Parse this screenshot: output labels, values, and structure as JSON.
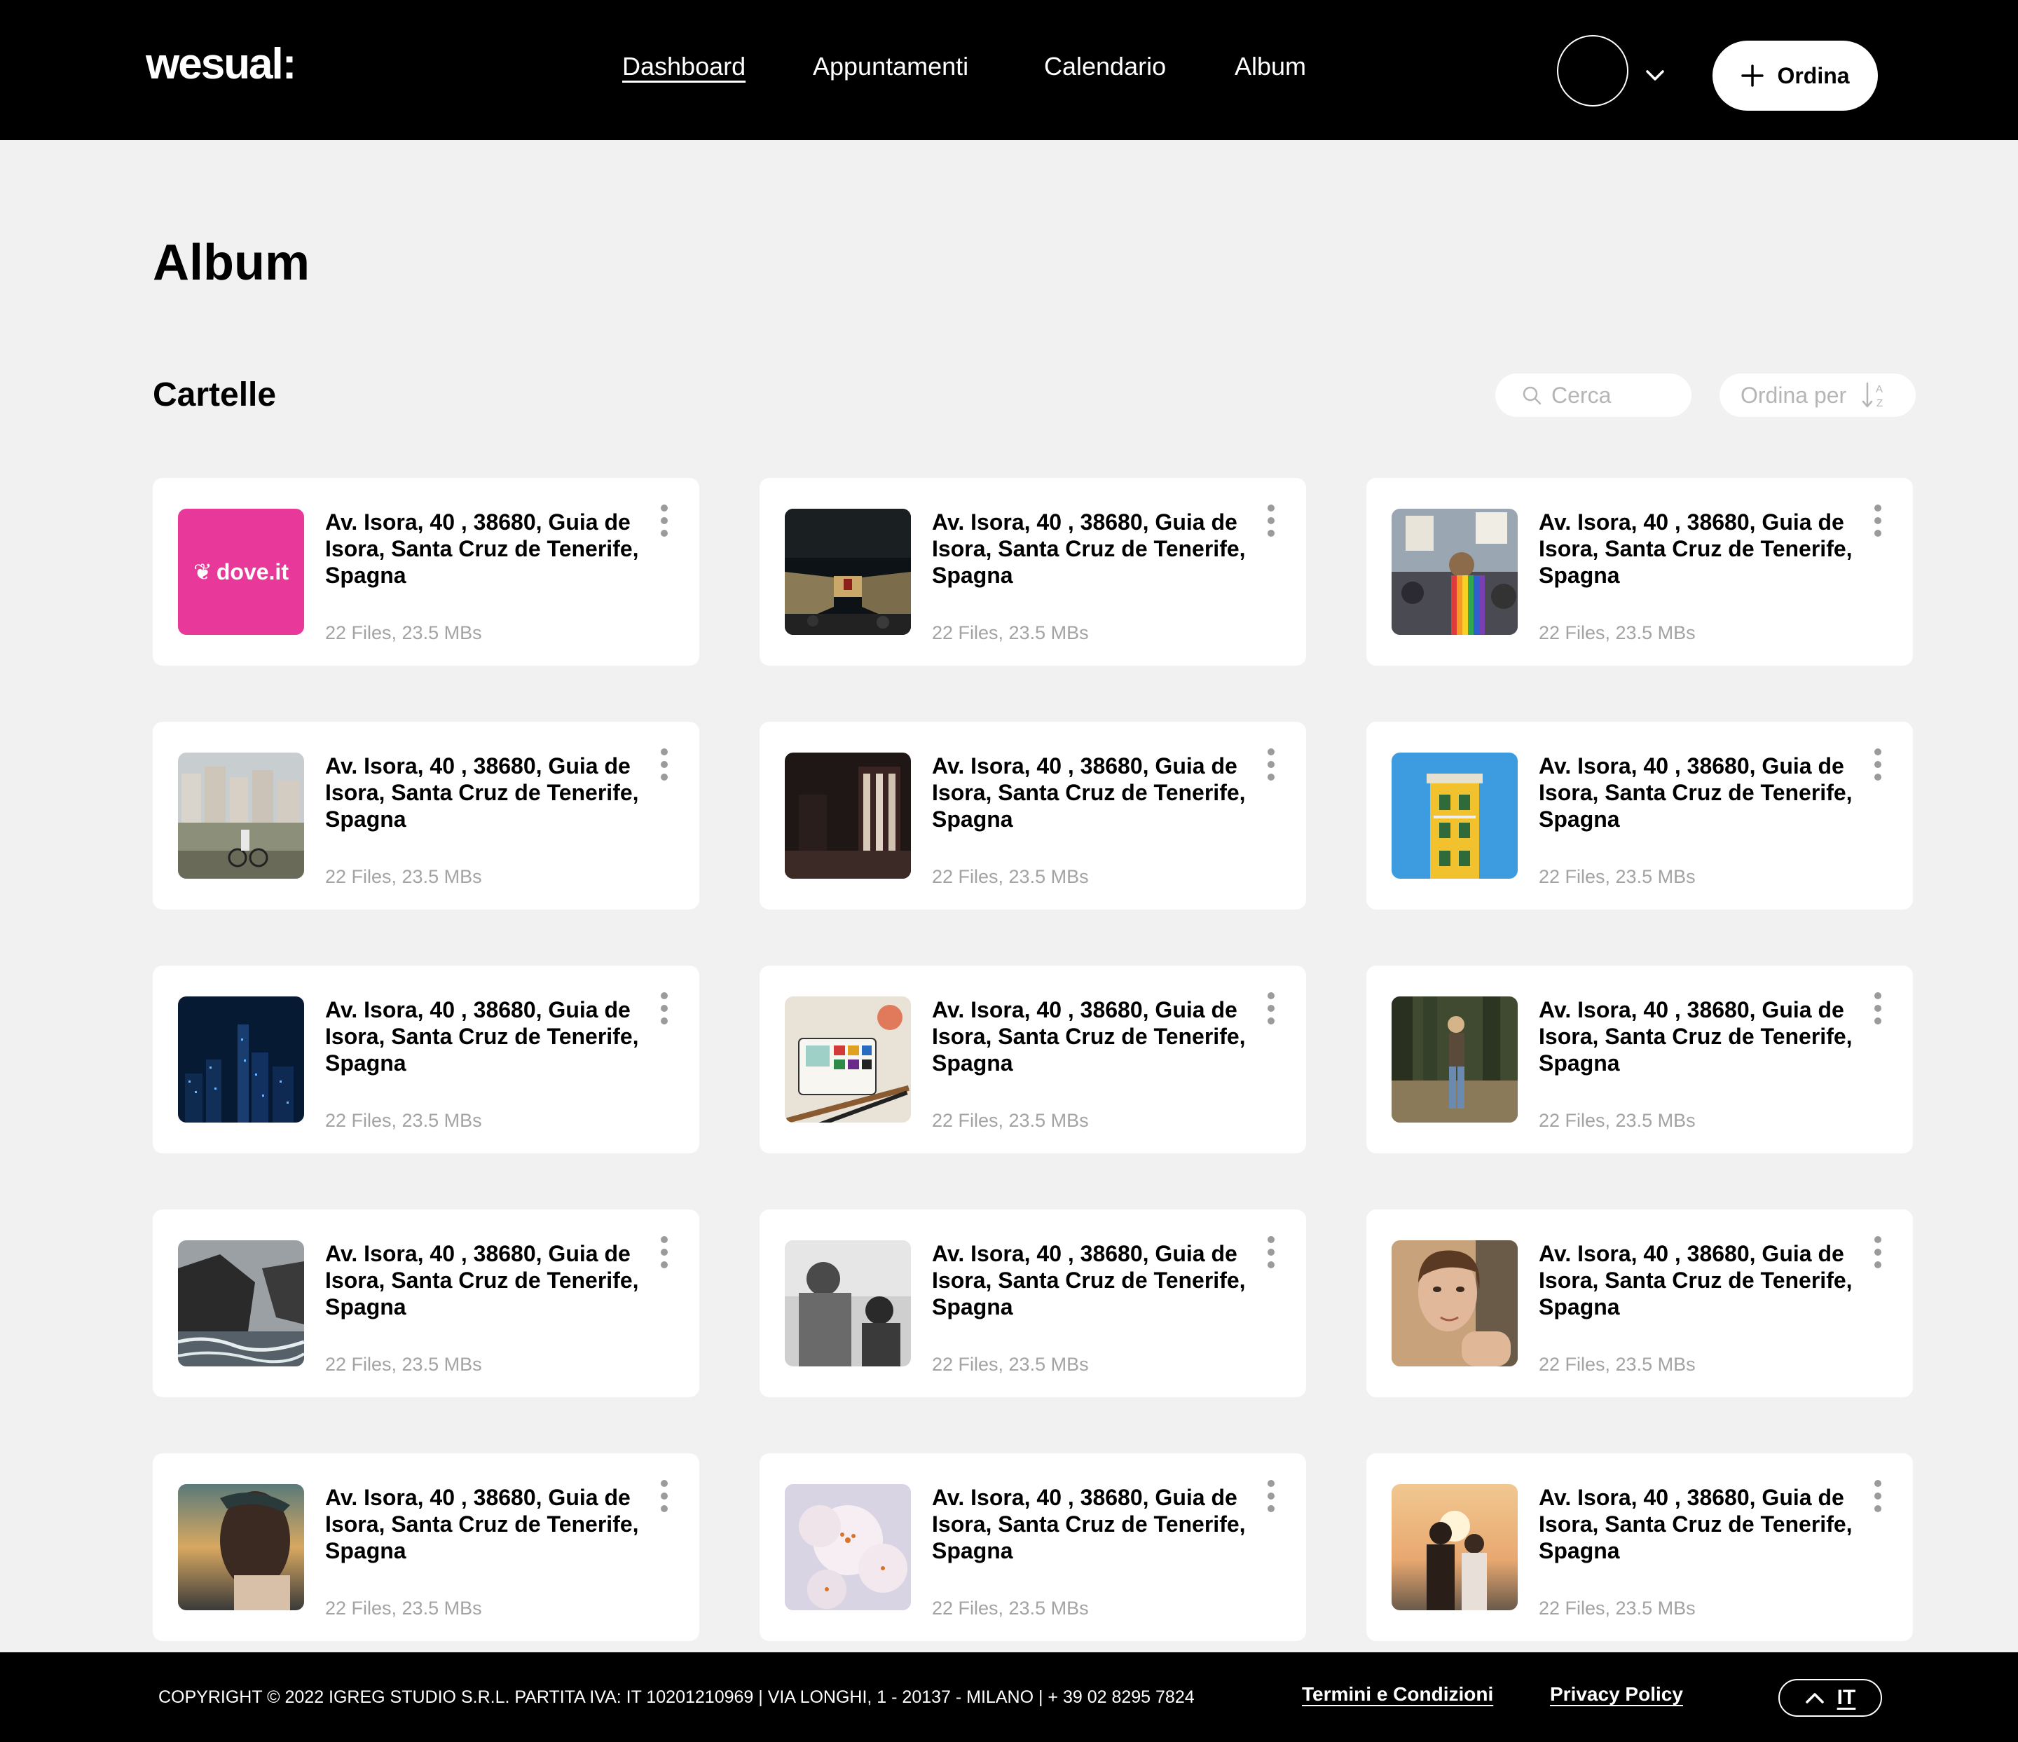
{
  "header": {
    "logo": "wesual:",
    "nav": [
      {
        "label": "Dashboard",
        "active": true
      },
      {
        "label": "Appuntamenti",
        "active": false
      },
      {
        "label": "Calendario",
        "active": false
      },
      {
        "label": "Album",
        "active": false
      }
    ],
    "order_label": "Ordina"
  },
  "page": {
    "title": "Album",
    "section_title": "Cartelle",
    "search_placeholder": "Cerca",
    "sort_label": "Ordina per"
  },
  "folders": [
    {
      "title": "Av. Isora, 40 , 38680, Guia de Isora, Santa Cruz de Tenerife, Spagna",
      "meta": "22 Files, 23.5 MBs",
      "thumb": "dove-logo",
      "thumb_text": "dove.it"
    },
    {
      "title": "Av. Isora, 40 , 38680, Guia de Isora, Santa Cruz de Tenerife, Spagna",
      "meta": "22 Files, 23.5 MBs",
      "thumb": "night-street"
    },
    {
      "title": "Av. Isora, 40 , 38680, Guia de Isora, Santa Cruz de Tenerife, Spagna",
      "meta": "22 Files, 23.5 MBs",
      "thumb": "pride-crowd"
    },
    {
      "title": "Av. Isora, 40 , 38680, Guia de Isora, Santa Cruz de Tenerife, Spagna",
      "meta": "22 Files, 23.5 MBs",
      "thumb": "lake-bicycle"
    },
    {
      "title": "Av. Isora, 40 , 38680, Guia de Isora, Santa Cruz de Tenerife, Spagna",
      "meta": "22 Files, 23.5 MBs",
      "thumb": "dark-interior"
    },
    {
      "title": "Av. Isora, 40 , 38680, Guia de Isora, Santa Cruz de Tenerife, Spagna",
      "meta": "22 Files, 23.5 MBs",
      "thumb": "yellow-building"
    },
    {
      "title": "Av. Isora, 40 , 38680, Guia de Isora, Santa Cruz de Tenerife, Spagna",
      "meta": "22 Files, 23.5 MBs",
      "thumb": "city-night"
    },
    {
      "title": "Av. Isora, 40 , 38680, Guia de Isora, Santa Cruz de Tenerife, Spagna",
      "meta": "22 Files, 23.5 MBs",
      "thumb": "watercolor-palette"
    },
    {
      "title": "Av. Isora, 40 , 38680, Guia de Isora, Santa Cruz de Tenerife, Spagna",
      "meta": "22 Files, 23.5 MBs",
      "thumb": "forest-woman"
    },
    {
      "title": "Av. Isora, 40 , 38680, Guia de Isora, Santa Cruz de Tenerife, Spagna",
      "meta": "22 Files, 23.5 MBs",
      "thumb": "rocky-coast"
    },
    {
      "title": "Av. Isora, 40 , 38680, Guia de Isora, Santa Cruz de Tenerife, Spagna",
      "meta": "22 Files, 23.5 MBs",
      "thumb": "bw-couple"
    },
    {
      "title": "Av. Isora, 40 , 38680, Guia de Isora, Santa Cruz de Tenerife, Spagna",
      "meta": "22 Files, 23.5 MBs",
      "thumb": "woman-portrait"
    },
    {
      "title": "Av. Isora, 40 , 38680, Guia de Isora, Santa Cruz de Tenerife, Spagna",
      "meta": "22 Files, 23.5 MBs",
      "thumb": "sunset-hair"
    },
    {
      "title": "Av. Isora, 40 , 38680, Guia de Isora, Santa Cruz de Tenerife, Spagna",
      "meta": "22 Files, 23.5 MBs",
      "thumb": "white-flowers"
    },
    {
      "title": "Av. Isora, 40 , 38680, Guia de Isora, Santa Cruz de Tenerife, Spagna",
      "meta": "22 Files, 23.5 MBs",
      "thumb": "sunset-couple"
    }
  ],
  "footer": {
    "copyright": "COPYRIGHT © 2022 IGREG STUDIO S.R.L. PARTITA IVA: IT 10201210969 | VIA LONGHI, 1 - 20137 - MILANO | + 39 02 8295 7824",
    "terms": "Termini e Condizioni",
    "privacy": "Privacy Policy",
    "lang": "IT"
  },
  "colors": {
    "header_bg": "#000000",
    "page_bg": "#f1f1f1",
    "card_bg": "#ffffff",
    "brand_pink": "#e8399a",
    "muted_text": "#a3a3a3"
  }
}
